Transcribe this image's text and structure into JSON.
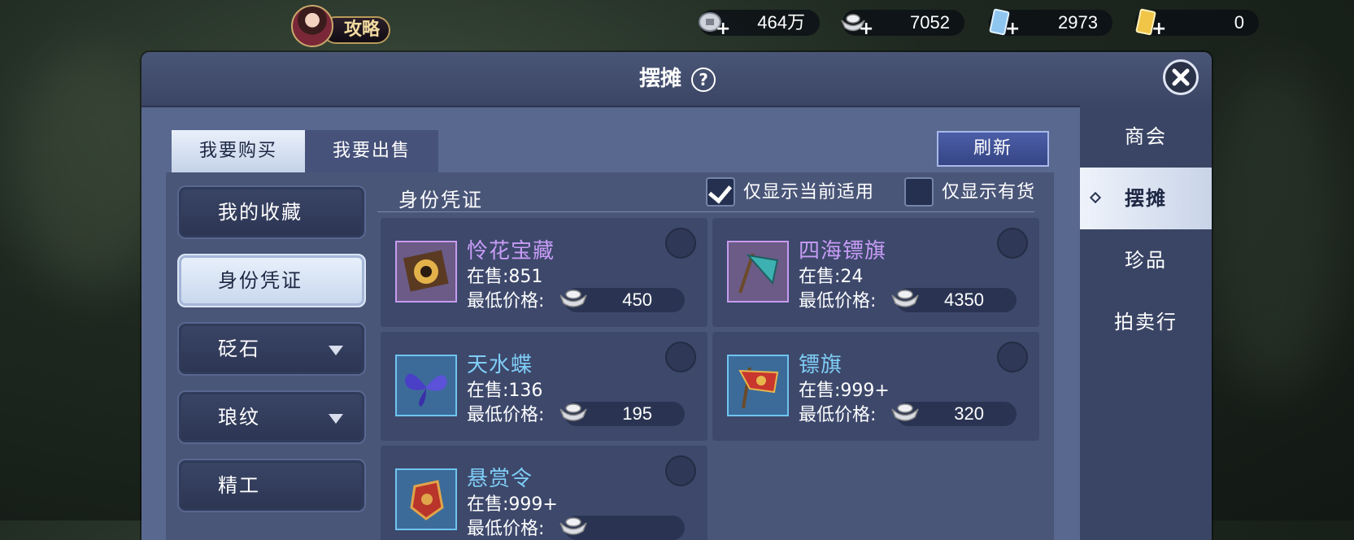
{
  "top": {
    "guide_label": "攻略",
    "currencies": [
      {
        "icon": "copper-coin-icon",
        "value": "464万"
      },
      {
        "icon": "silver-ingot-icon",
        "value": "7052"
      },
      {
        "icon": "blue-ticket-icon",
        "value": "2973"
      },
      {
        "icon": "gold-ticket-icon",
        "value": "0"
      }
    ],
    "plus": "+"
  },
  "panel": {
    "title": "摆摊",
    "help": "?",
    "tabs": [
      {
        "label": "我要购买",
        "active": true
      },
      {
        "label": "我要出售",
        "active": false
      }
    ],
    "refresh_label": "刷新",
    "right_nav": [
      {
        "label": "商会",
        "active": false
      },
      {
        "label": "摆摊",
        "active": true
      },
      {
        "label": "珍品",
        "active": false
      },
      {
        "label": "拍卖行",
        "active": false
      }
    ],
    "categories": [
      {
        "label": "我的收藏",
        "active": false,
        "has_arrow": false
      },
      {
        "label": "身份凭证",
        "active": true,
        "has_arrow": false
      },
      {
        "label": "砭石",
        "active": false,
        "has_arrow": true
      },
      {
        "label": "琅纹",
        "active": false,
        "has_arrow": true
      },
      {
        "label": "精工",
        "active": false,
        "has_arrow": false
      }
    ],
    "section_title": "身份凭证",
    "filters": [
      {
        "label": "仅显示当前适用",
        "checked": true
      },
      {
        "label": "仅显示有货",
        "checked": false
      }
    ],
    "price_label": "最低价格:",
    "items": [
      {
        "name": "怜花宝藏",
        "stock": "在售:851",
        "price": "450",
        "name_color": "#c79cf5",
        "icon": "treasure-compass-icon"
      },
      {
        "name": "四海镖旗",
        "stock": "在售:24",
        "price": "4350",
        "name_color": "#c79cf5",
        "icon": "escort-banner-icon"
      },
      {
        "name": "天水蝶",
        "stock": "在售:136",
        "price": "195",
        "name_color": "#7fcdf6",
        "icon": "butterfly-icon"
      },
      {
        "name": "镖旗",
        "stock": "在售:999+",
        "price": "320",
        "name_color": "#7fcdf6",
        "icon": "red-flag-icon"
      },
      {
        "name": "悬赏令",
        "stock": "在售:999+",
        "price": "",
        "name_color": "#7fcdf6",
        "icon": "bounty-token-icon"
      }
    ]
  }
}
